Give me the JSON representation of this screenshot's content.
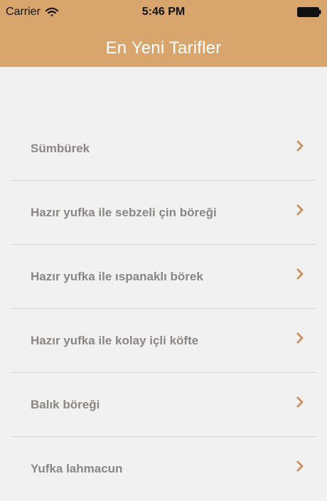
{
  "status_bar": {
    "carrier": "Carrier",
    "time": "5:46 PM",
    "wifi_icon": "wifi-icon",
    "battery_icon": "battery-icon"
  },
  "navigation": {
    "title": "En Yeni Tarifler",
    "background_color": "#d8a56c",
    "title_color": "#ffffff"
  },
  "recipes": {
    "items": [
      {
        "label": "Sümbürek"
      },
      {
        "label": "Hazır yufka ile sebzeli çin böreği"
      },
      {
        "label": "Hazır yufka ile ıspanaklı börek"
      },
      {
        "label": "Hazır yufka ile kolay içli köfte"
      },
      {
        "label": "Balık böreği"
      },
      {
        "label": "Yufka lahmacun"
      }
    ],
    "row_icon": "chevron-right-icon",
    "accent_color": "#c89465",
    "text_color": "#8b8683"
  },
  "theme": {
    "background": "#f2f1f1",
    "divider": "#d5d3d2"
  }
}
